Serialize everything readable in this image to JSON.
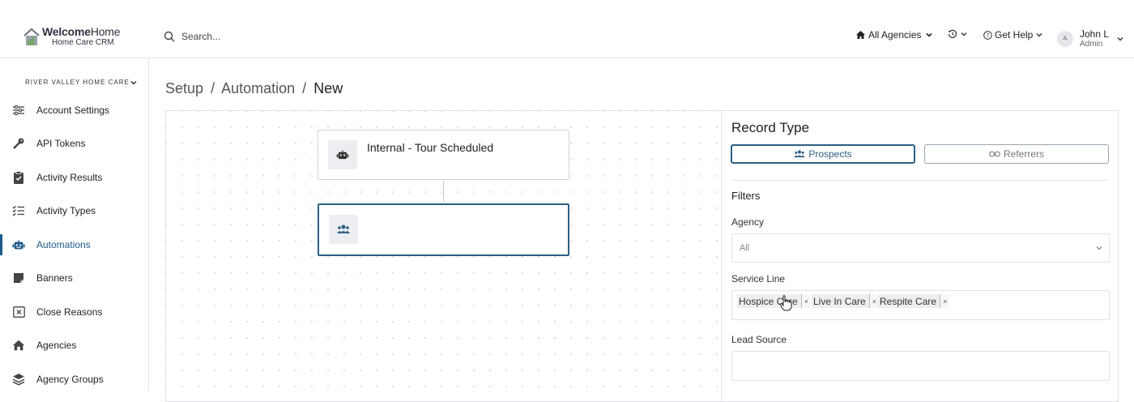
{
  "brand": {
    "title_bold": "Welcome",
    "title_light": "Home",
    "subtitle": "Home Care CRM"
  },
  "search": {
    "placeholder": "Search..."
  },
  "header": {
    "agencies_label": "All Agencies",
    "help_label": "Get Help",
    "user_initials": "JL",
    "user_name": "John L",
    "user_role": "Admin"
  },
  "sidebar": {
    "org_name": "RIVER VALLEY HOME CARE",
    "items": [
      {
        "label": "Account Settings",
        "icon": "sliders-icon"
      },
      {
        "label": "API Tokens",
        "icon": "key-icon"
      },
      {
        "label": "Activity Results",
        "icon": "clipboard-check-icon"
      },
      {
        "label": "Activity Types",
        "icon": "list-check-icon"
      },
      {
        "label": "Automations",
        "icon": "robot-icon",
        "active": true
      },
      {
        "label": "Banners",
        "icon": "note-icon"
      },
      {
        "label": "Close Reasons",
        "icon": "close-box-icon"
      },
      {
        "label": "Agencies",
        "icon": "home-icon"
      },
      {
        "label": "Agency Groups",
        "icon": "layers-icon"
      }
    ]
  },
  "breadcrumb": {
    "part1": "Setup",
    "part2": "Automation",
    "current": "New",
    "separator": "/"
  },
  "canvas": {
    "trigger_title": "Internal - Tour Scheduled",
    "action_title": ""
  },
  "panel": {
    "title": "Record Type",
    "toggle_prospects": "Prospects",
    "toggle_referrers": "Referrers",
    "filters_heading": "Filters",
    "agency_label": "Agency",
    "agency_value": "All",
    "service_line_label": "Service Line",
    "service_lines": [
      "Hospice Care",
      "Live In Care",
      "Respite Care"
    ],
    "tag_remove": "×",
    "lead_source_label": "Lead Source",
    "lead_source_value": ""
  },
  "colors": {
    "accent": "#2d5f84",
    "active_nav": "#1e5a8a",
    "logo_green": "#6aa84f"
  }
}
